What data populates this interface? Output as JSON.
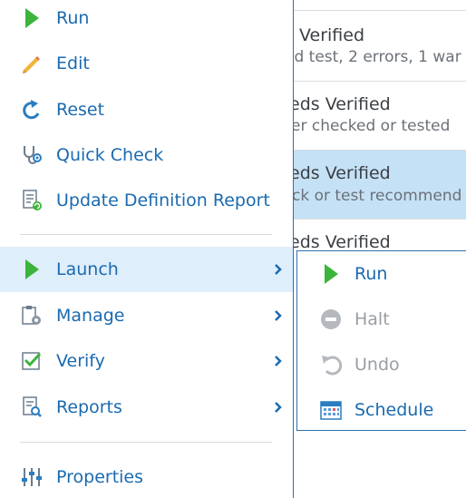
{
  "background_list": {
    "rows": [
      {
        "title": "",
        "sub": ""
      },
      {
        "title": "Verified",
        "sub": "ed test, 2 errors, 1 war"
      },
      {
        "title": "eds Verified",
        "sub": "er checked or tested"
      },
      {
        "title": "eds Verified",
        "sub": "ck or test recommend"
      },
      {
        "title": "eds Verified",
        "sub": ""
      }
    ]
  },
  "menu": {
    "items": [
      {
        "label": "Run",
        "icon": "play-icon"
      },
      {
        "label": "Edit",
        "icon": "pencil-icon"
      },
      {
        "label": "Reset",
        "icon": "reset-icon"
      },
      {
        "label": "Quick Check",
        "icon": "stethoscope-icon"
      },
      {
        "label": "Update Definition Report",
        "icon": "report-update-icon"
      },
      {
        "label": "Launch",
        "icon": "play-icon",
        "submenu": true
      },
      {
        "label": "Manage",
        "icon": "clipboard-gear-icon",
        "submenu": true
      },
      {
        "label": "Verify",
        "icon": "checkbox-icon",
        "submenu": true
      },
      {
        "label": "Reports",
        "icon": "report-search-icon",
        "submenu": true
      },
      {
        "label": "Properties",
        "icon": "sliders-icon"
      }
    ]
  },
  "submenu": {
    "items": [
      {
        "label": "Run",
        "icon": "play-icon",
        "enabled": true
      },
      {
        "label": "Halt",
        "icon": "halt-icon",
        "enabled": false
      },
      {
        "label": "Undo",
        "icon": "undo-icon",
        "enabled": false
      },
      {
        "label": "Schedule",
        "icon": "calendar-icon",
        "enabled": true
      }
    ]
  },
  "colors": {
    "accent": "#1a6ab0",
    "play_green": "#3cb43c",
    "selected_row": "#c5e1f6",
    "active_item": "#dfeefb",
    "disabled": "#9a9ea3"
  }
}
